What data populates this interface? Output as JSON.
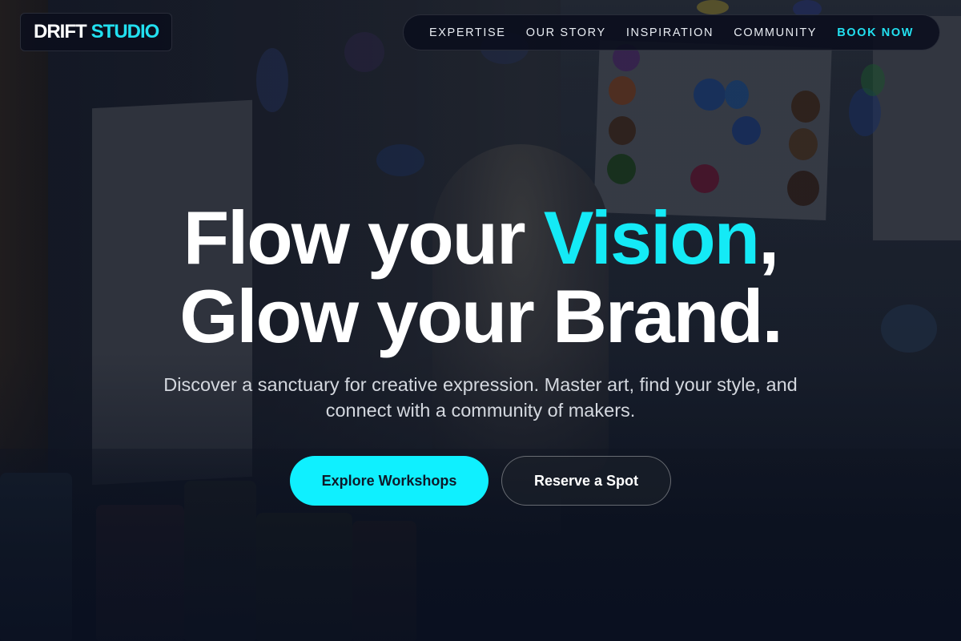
{
  "brand": {
    "name": "DRIFT",
    "accent": "STUDIO",
    "accent_color": "#22e0f0"
  },
  "nav": {
    "items": [
      {
        "label": "EXPERTISE"
      },
      {
        "label": "OUR STORY"
      },
      {
        "label": "INSPIRATION"
      },
      {
        "label": "COMMUNITY"
      }
    ],
    "cta_label": "BOOK NOW"
  },
  "hero": {
    "line1_pre": "Flow your ",
    "line1_highlight": "Vision",
    "line1_post": ",",
    "line2": "Glow your Brand.",
    "subtitle": "Discover a sanctuary for creative expression. Master art, find your style, and connect with a community of makers.",
    "highlight_color": "#14eaf6"
  },
  "buttons": {
    "primary_label": "Explore Workshops",
    "secondary_label": "Reserve a Spot",
    "primary_color": "#0ff0ff"
  }
}
